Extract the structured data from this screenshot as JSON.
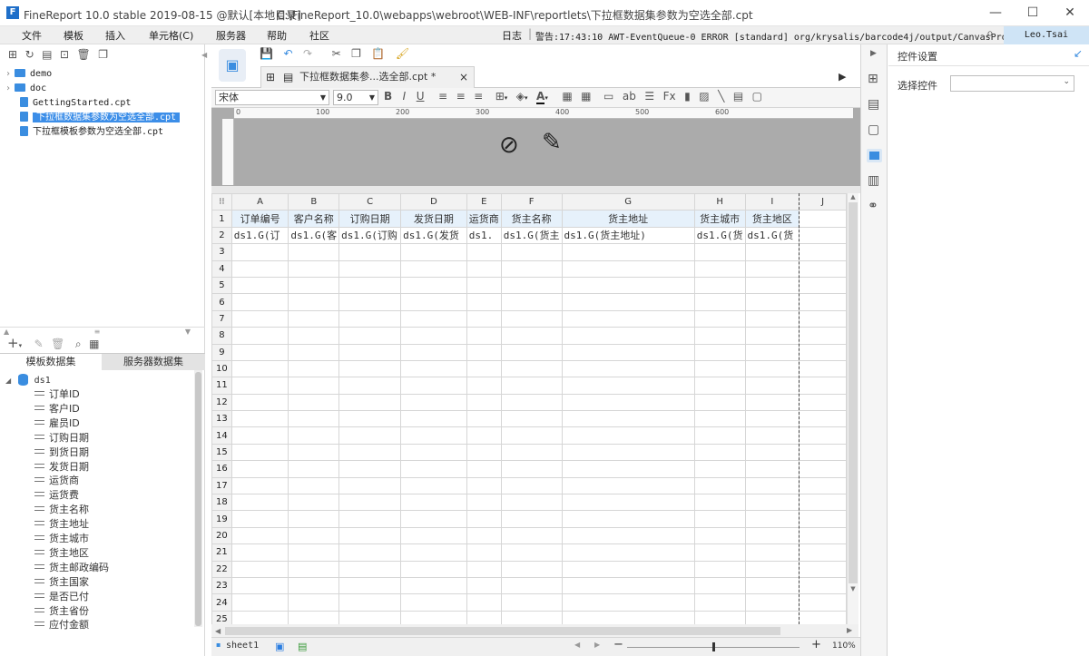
{
  "titlebar": {
    "app": "FineReport 10.0 stable 2019-08-15 @默认[本地目录]",
    "path": "C:\\FineReport_10.0\\webapps\\webroot\\WEB-INF\\reportlets\\下拉框数据集参数为空选全部.cpt"
  },
  "menu": [
    "文件",
    "模板",
    "插入",
    "单元格(C)",
    "服务器",
    "帮助",
    "社区"
  ],
  "log": {
    "label": "日志",
    "text": "警告:17:43:10 AWT-EventQueue-0 ERROR [standard] org/krysalis/barcode4j/output/CanvasProvider"
  },
  "user": "Leo.Tsai",
  "file_tree": [
    {
      "label": "demo",
      "type": "folder"
    },
    {
      "label": "doc",
      "type": "folder"
    },
    {
      "label": "GettingStarted.cpt",
      "type": "file"
    },
    {
      "label": "下拉框数据集参数为空选全部.cpt",
      "type": "file",
      "selected": true
    },
    {
      "label": "下拉框模板参数为空选全部.cpt",
      "type": "file"
    }
  ],
  "dataset_tabs": [
    "模板数据集",
    "服务器数据集"
  ],
  "dataset": {
    "name": "ds1",
    "fields": [
      "订单ID",
      "客户ID",
      "雇员ID",
      "订购日期",
      "到货日期",
      "发货日期",
      "运货商",
      "运货费",
      "货主名称",
      "货主地址",
      "货主城市",
      "货主地区",
      "货主邮政编码",
      "货主国家",
      "是否已付",
      "货主省份",
      "应付金额"
    ]
  },
  "doc_tab": {
    "label": "下拉框数据集参...选全部.cpt *",
    "close": "×"
  },
  "format": {
    "font": "宋体",
    "size": "9.0"
  },
  "ruler": {
    "ticks": [
      "0",
      "100",
      "200",
      "300",
      "400",
      "500",
      "600"
    ]
  },
  "sheet": {
    "columns": [
      "A",
      "B",
      "C",
      "D",
      "E",
      "F",
      "G",
      "H",
      "I",
      "J"
    ],
    "row1": [
      "订单编号",
      "客户名称",
      "订购日期",
      "发货日期",
      "运货商",
      "货主名称",
      "货主地址",
      "货主城市",
      "货主地区",
      ""
    ],
    "row2": [
      "ds1.G(订",
      "ds1.G(客",
      "ds1.G(订购",
      "ds1.G(发货",
      "ds1.",
      "ds1.G(货主",
      "ds1.G(货主地址)",
      "ds1.G(货",
      "ds1.G(货",
      ""
    ],
    "row_count": 25
  },
  "status": {
    "sheet": "sheet1",
    "zoom": "110%"
  },
  "right_panel": {
    "title": "控件设置",
    "select_label": "选择控件",
    "select_value": ""
  },
  "colors": {
    "accent": "#3c8ee8",
    "header_fill": "#e6f1fb",
    "gray_area": "#ababab"
  }
}
